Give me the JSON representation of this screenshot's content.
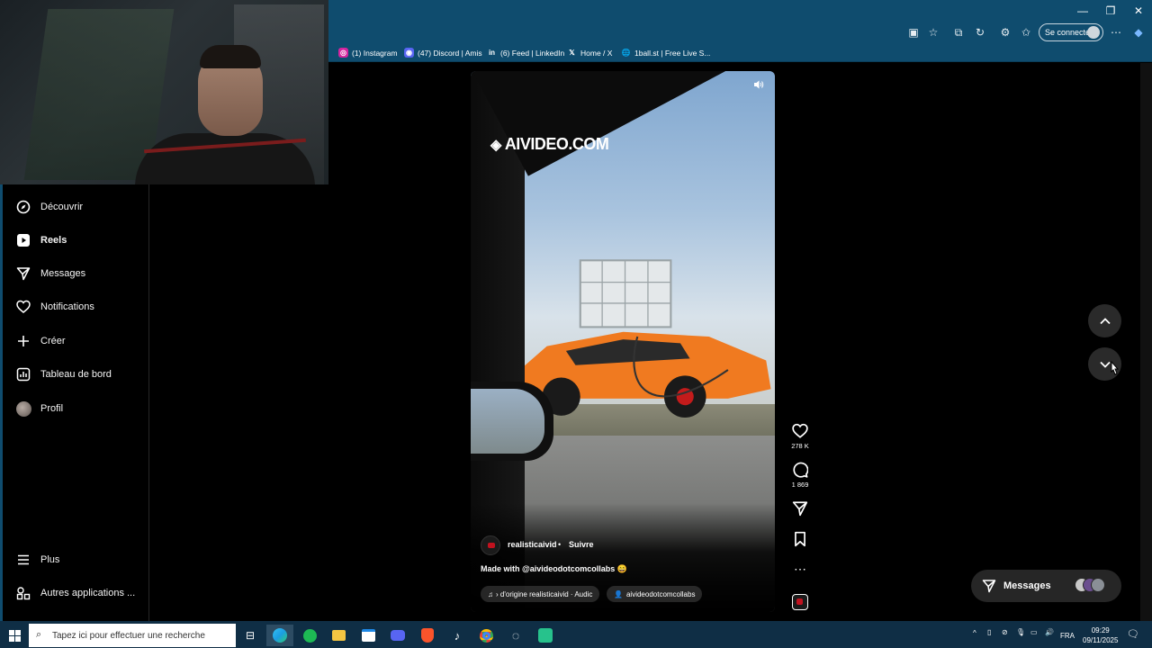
{
  "browser": {
    "signin_label": "Se connecter",
    "bookmarks": [
      {
        "label": "(1) Instagram",
        "icon": "instagram-icon"
      },
      {
        "label": "(47) Discord | Amis",
        "icon": "discord-icon"
      },
      {
        "label": "(6) Feed | LinkedIn",
        "icon": "linkedin-icon"
      },
      {
        "label": "Home / X",
        "icon": "x-icon"
      },
      {
        "label": "1ball.st | Free Live S...",
        "icon": "globe-icon"
      }
    ]
  },
  "sidebar": {
    "items": [
      {
        "label": "Découvrir",
        "icon": "compass-icon"
      },
      {
        "label": "Reels",
        "icon": "reels-icon"
      },
      {
        "label": "Messages",
        "icon": "paper-plane-icon"
      },
      {
        "label": "Notifications",
        "icon": "heart-icon"
      },
      {
        "label": "Créer",
        "icon": "plus-icon"
      },
      {
        "label": "Tableau de bord",
        "icon": "dashboard-icon"
      },
      {
        "label": "Profil",
        "icon": "avatar"
      }
    ],
    "bottom": [
      {
        "label": "Plus",
        "icon": "menu-icon"
      },
      {
        "label": "Autres applications ...",
        "icon": "apps-icon"
      }
    ]
  },
  "reel": {
    "watermark": "AIVIDEO.COM",
    "author": "realisticaivid",
    "follow_label": "Suivre",
    "separator": "•",
    "caption": "Made with @aivideodotcomcollabs 😄",
    "audio_chip": "› d'origine   realisticaivid · Audic",
    "tag_chip": "aivideodotcomcollabs",
    "likes": "278 K",
    "comments": "1 869"
  },
  "messages_pill": {
    "label": "Messages"
  },
  "taskbar": {
    "search_placeholder": "Tapez ici pour effectuer une recherche",
    "lang": "FRA",
    "time": "09:29",
    "date": "09/11/2025"
  },
  "colors": {
    "chrome": "#0f4c6e",
    "taskbar": "#0f2e45",
    "background": "#000000",
    "car": "#f07a20"
  }
}
